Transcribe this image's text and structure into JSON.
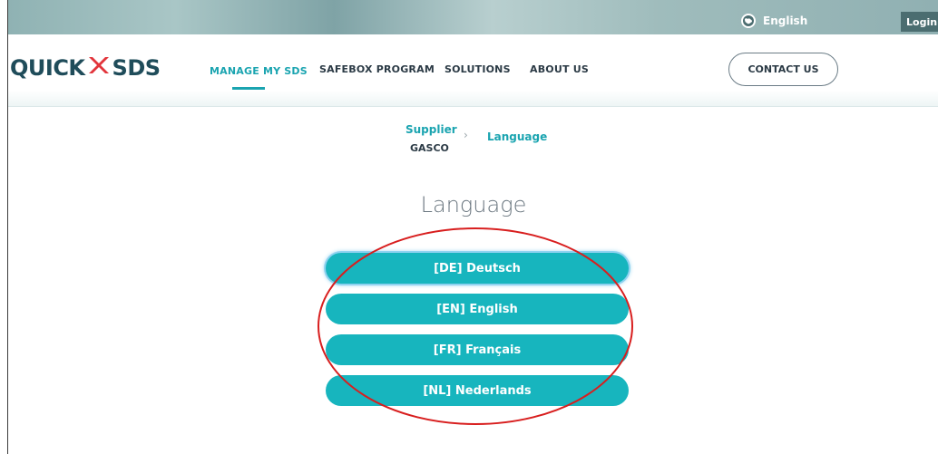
{
  "topbar": {
    "language": "English",
    "login": "Login"
  },
  "header": {
    "logo_left": "QUICK",
    "logo_right": "SDS",
    "nav": {
      "manage": "MANAGE MY SDS",
      "safebox": "SAFEBOX PROGRAM",
      "solutions": "SOLUTIONS",
      "about": "ABOUT US"
    },
    "contact": "CONTACT US"
  },
  "breadcrumb": {
    "supplier_label": "Supplier",
    "supplier_name": "GASCO",
    "separator": "›",
    "current": "Language"
  },
  "page_title": "Language",
  "languages": [
    {
      "label": "[DE] Deutsch"
    },
    {
      "label": "[EN] English"
    },
    {
      "label": "[FR] Français"
    },
    {
      "label": "[NL] Nederlands"
    }
  ],
  "colors": {
    "accent": "#17b5be",
    "brand_dark": "#1f4c5a",
    "logo_red": "#e2343b",
    "annotation": "#d81e1e"
  },
  "icons": {
    "language": "globe-icon",
    "logo": "double-chevron-icon",
    "breadcrumb": "chevron-right-icon"
  }
}
